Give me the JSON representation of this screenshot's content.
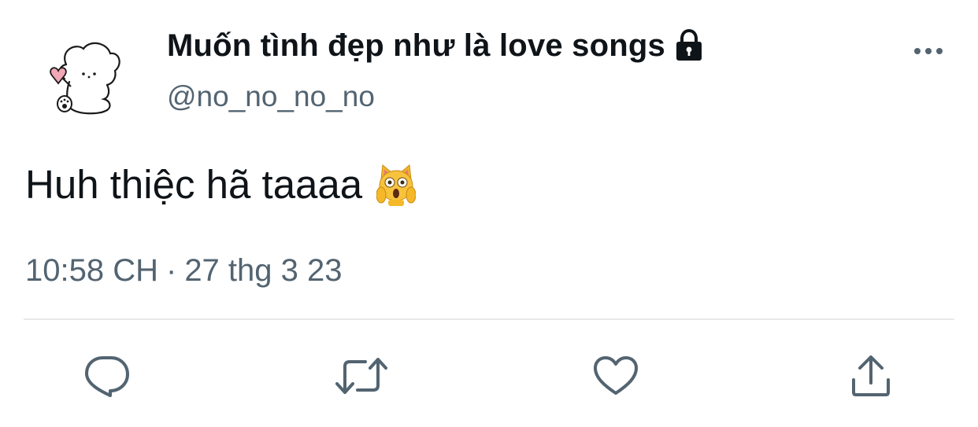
{
  "tweet": {
    "display_name": "Muốn tình đẹp như là love songs",
    "handle": "@no_no_no_no",
    "protected": true,
    "text": "Huh thiệc hã taaaa",
    "emoji": "😱",
    "time": "10:58 CH",
    "separator": "·",
    "date": "27 thg 3 23"
  },
  "icons": {
    "avatar": "cartoon-puppy-with-heart",
    "lock": "lock-icon",
    "more": "more-horizontal-icon",
    "reply": "reply-icon",
    "retweet": "retweet-icon",
    "like": "heart-icon",
    "share": "share-icon"
  },
  "colors": {
    "text_primary": "#0f1419",
    "text_secondary": "#536471",
    "divider": "#e7e9ea",
    "icon": "#536471"
  }
}
